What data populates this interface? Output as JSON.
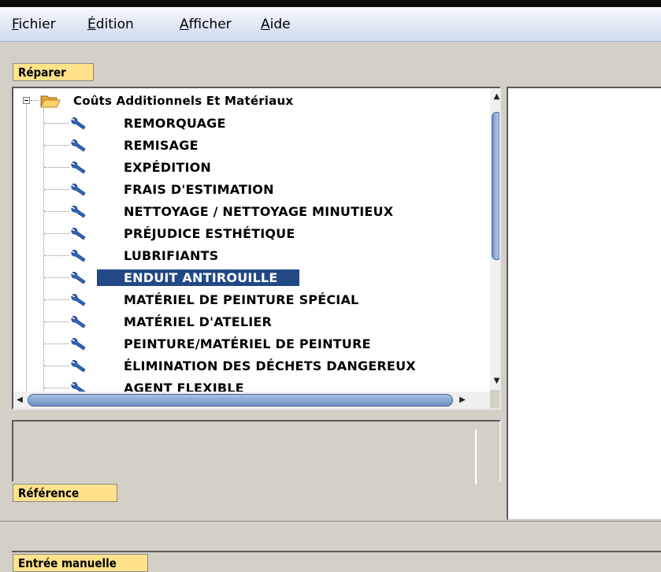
{
  "menu": {
    "items": [
      {
        "accel": "F",
        "rest": "ichier"
      },
      {
        "accel": "É",
        "rest": "dition"
      },
      {
        "accel": "A",
        "rest": "fficher"
      },
      {
        "accel": "A",
        "rest": "ide"
      }
    ]
  },
  "tabs": {
    "repair": "Réparer",
    "reference": "Référence",
    "manual_entry": "Entrée manuelle"
  },
  "tree": {
    "root_label": "Coûts Additionnels Et Matériaux",
    "selected_index": 7,
    "items": [
      "REMORQUAGE",
      "REMISAGE",
      "EXPÉDITION",
      "FRAIS D'ESTIMATION",
      "NETTOYAGE / NETTOYAGE MINUTIEUX",
      "PRÉJUDICE ESTHÉTIQUE",
      "LUBRIFIANTS",
      "ENDUIT ANTIROUILLE",
      "MATÉRIEL DE PEINTURE SPÉCIAL",
      "MATÉRIEL D'ATELIER",
      "PEINTURE/MATÉRIEL DE PEINTURE",
      "ÉLIMINATION DES DÉCHETS DANGEREUX",
      "AGENT FLEXIBLE"
    ]
  },
  "colors": {
    "tab_bg": "#ffe28a",
    "selection": "#224985",
    "scroll_thumb": "#6f8fc0"
  }
}
